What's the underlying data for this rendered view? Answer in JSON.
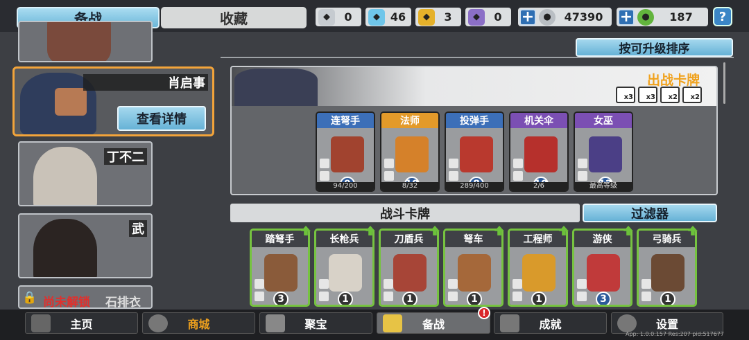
{
  "tabs": {
    "prep": "备战",
    "fav": "收藏"
  },
  "resources": [
    {
      "icon": "silver-shield-icon",
      "value": "0"
    },
    {
      "icon": "blue-crystal-icon",
      "value": "46"
    },
    {
      "icon": "gold-shield-icon",
      "value": "3"
    },
    {
      "icon": "purple-shield-icon",
      "value": "0"
    }
  ],
  "coins": {
    "value": "47390"
  },
  "gems": {
    "value": "187"
  },
  "help": "?",
  "heroes": {
    "selected": {
      "name": "肖启事",
      "detail": "查看详情"
    },
    "list": [
      {
        "name": "丁不二"
      },
      {
        "name": "武"
      }
    ],
    "locked": {
      "name": "石排衣",
      "lock": "尚未解锁"
    }
  },
  "sort_button": "按可升级排序",
  "deploy": {
    "title": "出战卡牌",
    "bonus": [
      "x3",
      "x3",
      "x2",
      "x2"
    ],
    "cards": [
      {
        "name": "连弩手",
        "level": "9",
        "progress": "94/200",
        "color": "#3c6fb8"
      },
      {
        "name": "法师",
        "level": "10",
        "progress": "8/32",
        "color": "#e39a2a"
      },
      {
        "name": "投弹手",
        "level": "8",
        "progress": "289/400",
        "color": "#3c6fb8"
      },
      {
        "name": "机关伞",
        "level": "10",
        "progress": "2/6",
        "color": "#7b4fb3"
      },
      {
        "name": "女巫",
        "level": "12",
        "progress": "最高等级",
        "color": "#7b4fb3"
      }
    ]
  },
  "battle": {
    "title": "战斗卡牌",
    "filter": "过滤器",
    "cards": [
      {
        "name": "踏弩手",
        "level": "3"
      },
      {
        "name": "长枪兵",
        "level": "1"
      },
      {
        "name": "刀盾兵",
        "level": "1"
      },
      {
        "name": "弩车",
        "level": "1"
      },
      {
        "name": "工程师",
        "level": "1"
      },
      {
        "name": "游侠",
        "level": "3"
      },
      {
        "name": "弓骑兵",
        "level": "1"
      }
    ]
  },
  "nav": [
    {
      "label": "主页",
      "color": "#ffffff"
    },
    {
      "label": "商城",
      "color": "#f0a21d"
    },
    {
      "label": "聚宝",
      "color": "#ffffff"
    },
    {
      "label": "备战",
      "color": "#ffffff"
    },
    {
      "label": "成就",
      "color": "#ffffff"
    },
    {
      "label": "设置",
      "color": "#ffffff"
    }
  ],
  "nav_badge": "!",
  "version": "App: 1.0.0.157 Res:207 pid:517677"
}
